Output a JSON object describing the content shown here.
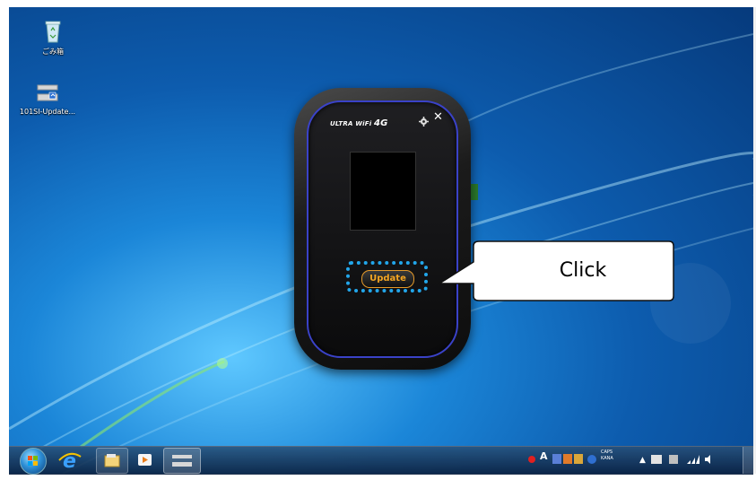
{
  "desktop": {
    "icons": [
      {
        "label": "ごみ箱",
        "icon": "recycle-bin-icon"
      },
      {
        "label": "101SI-Update...",
        "icon": "device-shortcut-icon"
      }
    ]
  },
  "updater": {
    "brand": "ULTRA WiFi",
    "brand_suffix": "4G",
    "update_label": "Update",
    "close_icon": "close-icon",
    "settings_icon": "gear-icon"
  },
  "callout": {
    "text": "Click"
  },
  "taskbar": {
    "pinned": [
      "start-orb",
      "internet-explorer-icon",
      "file-explorer-icon",
      "media-player-icon",
      "device-app-icon"
    ],
    "tray": {
      "ime_label": "A",
      "caps": "CAPS",
      "kana": "KANA"
    }
  },
  "colors": {
    "highlight": "#22a6ea",
    "update_text": "#f5a623",
    "device_ring": "#3a42c8"
  }
}
